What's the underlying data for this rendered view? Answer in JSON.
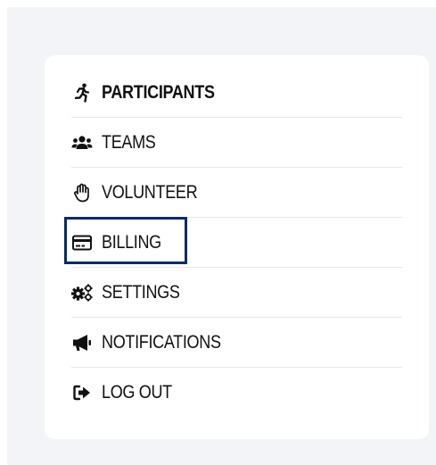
{
  "menu": {
    "items": [
      {
        "label": "PARTICIPANTS",
        "icon": "running-person-icon",
        "active": true
      },
      {
        "label": "TEAMS",
        "icon": "users-icon"
      },
      {
        "label": "VOLUNTEER",
        "icon": "hand-icon"
      },
      {
        "label": "BILLING",
        "icon": "credit-card-icon",
        "focused": true
      },
      {
        "label": "SETTINGS",
        "icon": "gears-icon"
      },
      {
        "label": "NOTIFICATIONS",
        "icon": "megaphone-icon"
      },
      {
        "label": "LOG OUT",
        "icon": "sign-out-icon"
      }
    ]
  },
  "colors": {
    "text": "#111111",
    "focus_ring": "#0c2a66",
    "panel_bg": "#f2f4f7",
    "card_bg": "#ffffff",
    "divider": "#e5e7ea"
  }
}
